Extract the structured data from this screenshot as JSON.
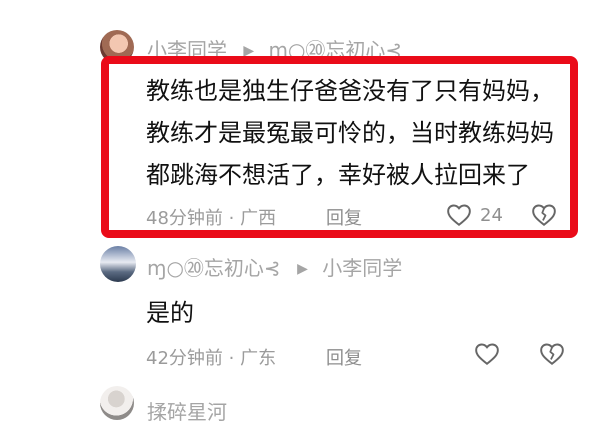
{
  "comments": [
    {
      "author": "小李同学",
      "reply_to": "ɱ○⑳忘初心⊰",
      "text_lines": [
        "教练也是独生仔爸爸没有了只有妈妈，",
        "教练才是最冤最可怜的，当时教练妈妈",
        "都跳海不想活了，幸好被人拉回来了"
      ],
      "time_location": "48分钟前 · 广西",
      "reply_label": "回复",
      "like_count": "24"
    },
    {
      "author": "ɱ○⑳忘初心⊰",
      "reply_to": "小李同学",
      "text_lines": [
        "是的"
      ],
      "time_location": "42分钟前 · 广东",
      "reply_label": "回复",
      "like_count": ""
    },
    {
      "author": "揉碎星河"
    }
  ],
  "colors": {
    "highlight": "#ea0b19",
    "meta_text": "#9b9b9b",
    "body_text": "#111111"
  }
}
